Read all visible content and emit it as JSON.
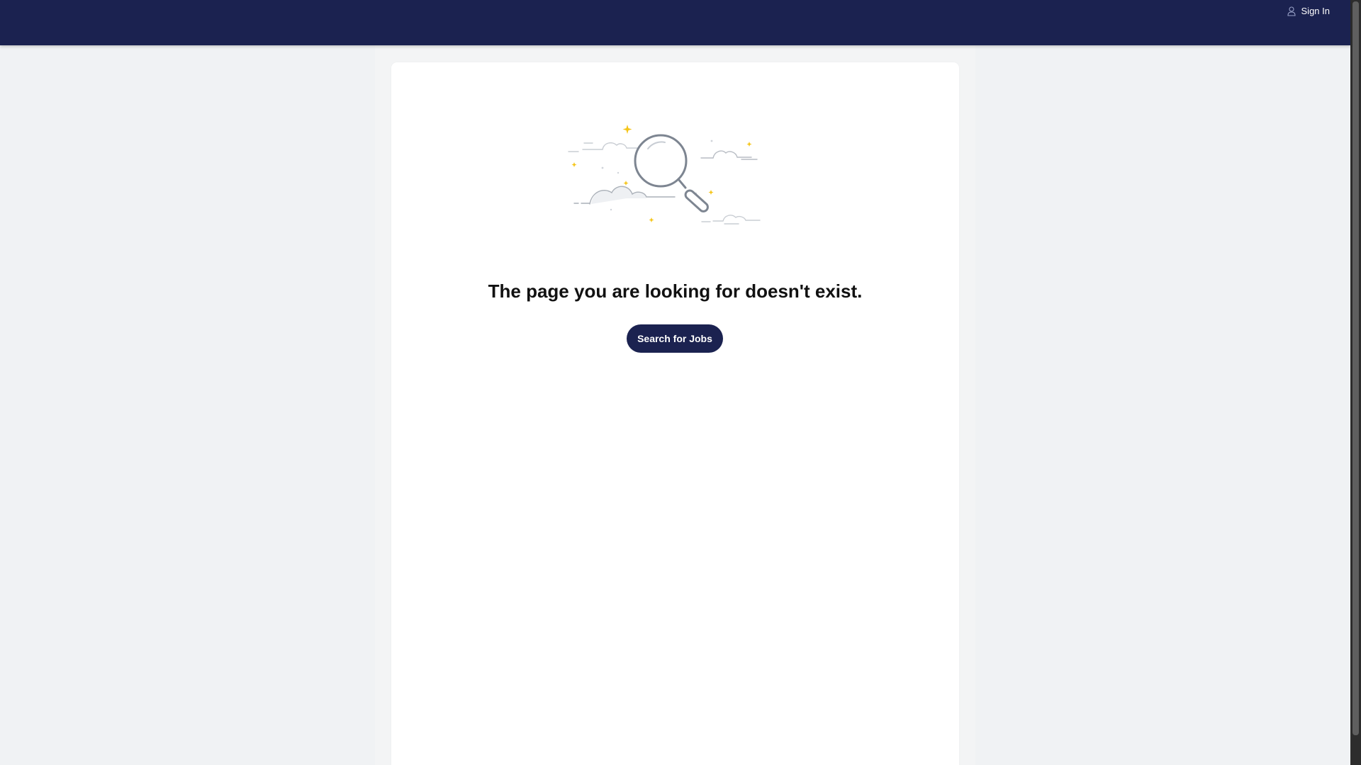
{
  "header": {
    "signin_label": "Sign In",
    "user_icon": "user-icon"
  },
  "main": {
    "illustration_icon": "magnifier-clouds-illustration",
    "heading": "The page you are looking for doesn't exist.",
    "cta_label": "Search for Jobs"
  },
  "colors": {
    "header_bg": "#1b2250",
    "page_bg": "#f0f2f4",
    "card_bg": "#ffffff",
    "button_bg": "#1b2250",
    "sparkle": "#f5c518"
  }
}
